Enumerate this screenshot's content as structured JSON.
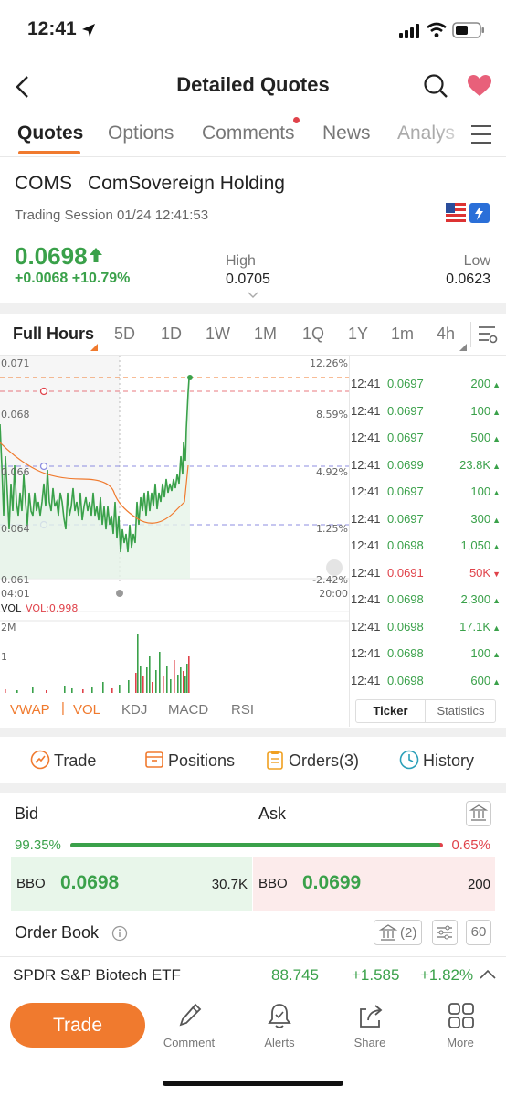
{
  "status": {
    "time": "12:41"
  },
  "nav": {
    "title": "Detailed Quotes"
  },
  "tabs": [
    "Quotes",
    "Options",
    "Comments",
    "News",
    "Analys"
  ],
  "stock": {
    "symbol": "COMS",
    "name": "ComSovereign Holding",
    "session": "Trading Session 01/24 12:41:53",
    "price": "0.0698",
    "change": "+0.0068",
    "change_pct": "+10.79%",
    "high_label": "High",
    "high": "0.0705",
    "low_label": "Low",
    "low": "0.0623"
  },
  "periods": [
    "Full Hours",
    "5D",
    "1D",
    "1W",
    "1M",
    "1Q",
    "1Y",
    "1m",
    "4h"
  ],
  "chart_data": {
    "type": "line",
    "y_labels": [
      "0.071",
      "0.068",
      "0.066",
      "0.064",
      "0.061"
    ],
    "pct_labels": [
      "12.26%",
      "8.59%",
      "4.92%",
      "1.25%",
      "-2.42%"
    ],
    "x_labels": [
      "04:01",
      "20:00"
    ],
    "vol_label": "VOL",
    "vol_value": "VOL:0.998",
    "vol_axis": [
      "2M",
      "1"
    ],
    "colors": {
      "up": "#3aa14a",
      "down": "#e0424a",
      "avg": "#f07a2e"
    }
  },
  "ticker": [
    {
      "time": "12:41",
      "price": "0.0697",
      "vol": "200",
      "dir": "up"
    },
    {
      "time": "12:41",
      "price": "0.0697",
      "vol": "100",
      "dir": "up"
    },
    {
      "time": "12:41",
      "price": "0.0697",
      "vol": "500",
      "dir": "up"
    },
    {
      "time": "12:41",
      "price": "0.0699",
      "vol": "23.8K",
      "dir": "up"
    },
    {
      "time": "12:41",
      "price": "0.0697",
      "vol": "100",
      "dir": "up"
    },
    {
      "time": "12:41",
      "price": "0.0697",
      "vol": "300",
      "dir": "up"
    },
    {
      "time": "12:41",
      "price": "0.0698",
      "vol": "1,050",
      "dir": "up"
    },
    {
      "time": "12:41",
      "price": "0.0691",
      "vol": "50K",
      "dir": "down"
    },
    {
      "time": "12:41",
      "price": "0.0698",
      "vol": "2,300",
      "dir": "up"
    },
    {
      "time": "12:41",
      "price": "0.0698",
      "vol": "17.1K",
      "dir": "up"
    },
    {
      "time": "12:41",
      "price": "0.0698",
      "vol": "100",
      "dir": "up"
    },
    {
      "time": "12:41",
      "price": "0.0698",
      "vol": "600",
      "dir": "up"
    }
  ],
  "ticker_tabs": [
    "Ticker",
    "Statistics"
  ],
  "indicators": [
    "VWAP",
    "VOL",
    "KDJ",
    "MACD",
    "RSI"
  ],
  "actions": [
    "Trade",
    "Positions",
    "Orders(3)",
    "History"
  ],
  "book": {
    "bid_label": "Bid",
    "ask_label": "Ask",
    "bid_pct": "99.35%",
    "ask_pct": "0.65%",
    "bid_ratio": 0.9935,
    "bbo_label": "BBO",
    "bid_price": "0.0698",
    "bid_size": "30.7K",
    "ask_price": "0.0699",
    "ask_size": "200",
    "order_book_label": "Order Book",
    "exchange_count": "(2)",
    "depth": "60"
  },
  "related": {
    "name": "SPDR S&P Biotech ETF",
    "price": "88.745",
    "change": "+1.585",
    "change_pct": "+1.82%"
  },
  "bottom": {
    "trade": "Trade",
    "comment": "Comment",
    "alerts": "Alerts",
    "share": "Share",
    "more": "More"
  }
}
